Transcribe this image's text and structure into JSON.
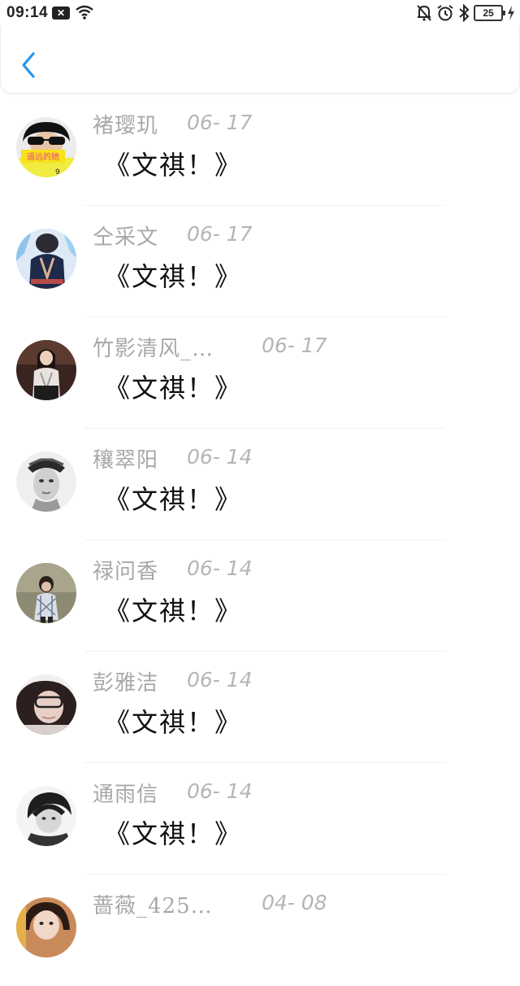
{
  "status_bar": {
    "time": "09:14",
    "battery": "25"
  },
  "header": {
    "back_icon": "chevron-left-icon",
    "accent": "#2196f3"
  },
  "items": [
    {
      "name": "褚璎玑",
      "date": "06- 17",
      "message": "《文祺！》",
      "avatar_text": "遥远的她"
    },
    {
      "name": "仝采文",
      "date": "06- 17",
      "message": "《文祺！》"
    },
    {
      "name": "竹影清风_…",
      "date": "06- 17",
      "message": "《文祺！》"
    },
    {
      "name": "穰翠阳",
      "date": "06- 14",
      "message": "《文祺！》"
    },
    {
      "name": "禄问香",
      "date": "06- 14",
      "message": "《文祺！》"
    },
    {
      "name": "彭雅洁",
      "date": "06- 14",
      "message": "《文祺！》"
    },
    {
      "name": "通雨信",
      "date": "06- 14",
      "message": "《文祺！》"
    },
    {
      "name": "蔷薇_4251…",
      "date": "04- 08",
      "message": ""
    }
  ]
}
